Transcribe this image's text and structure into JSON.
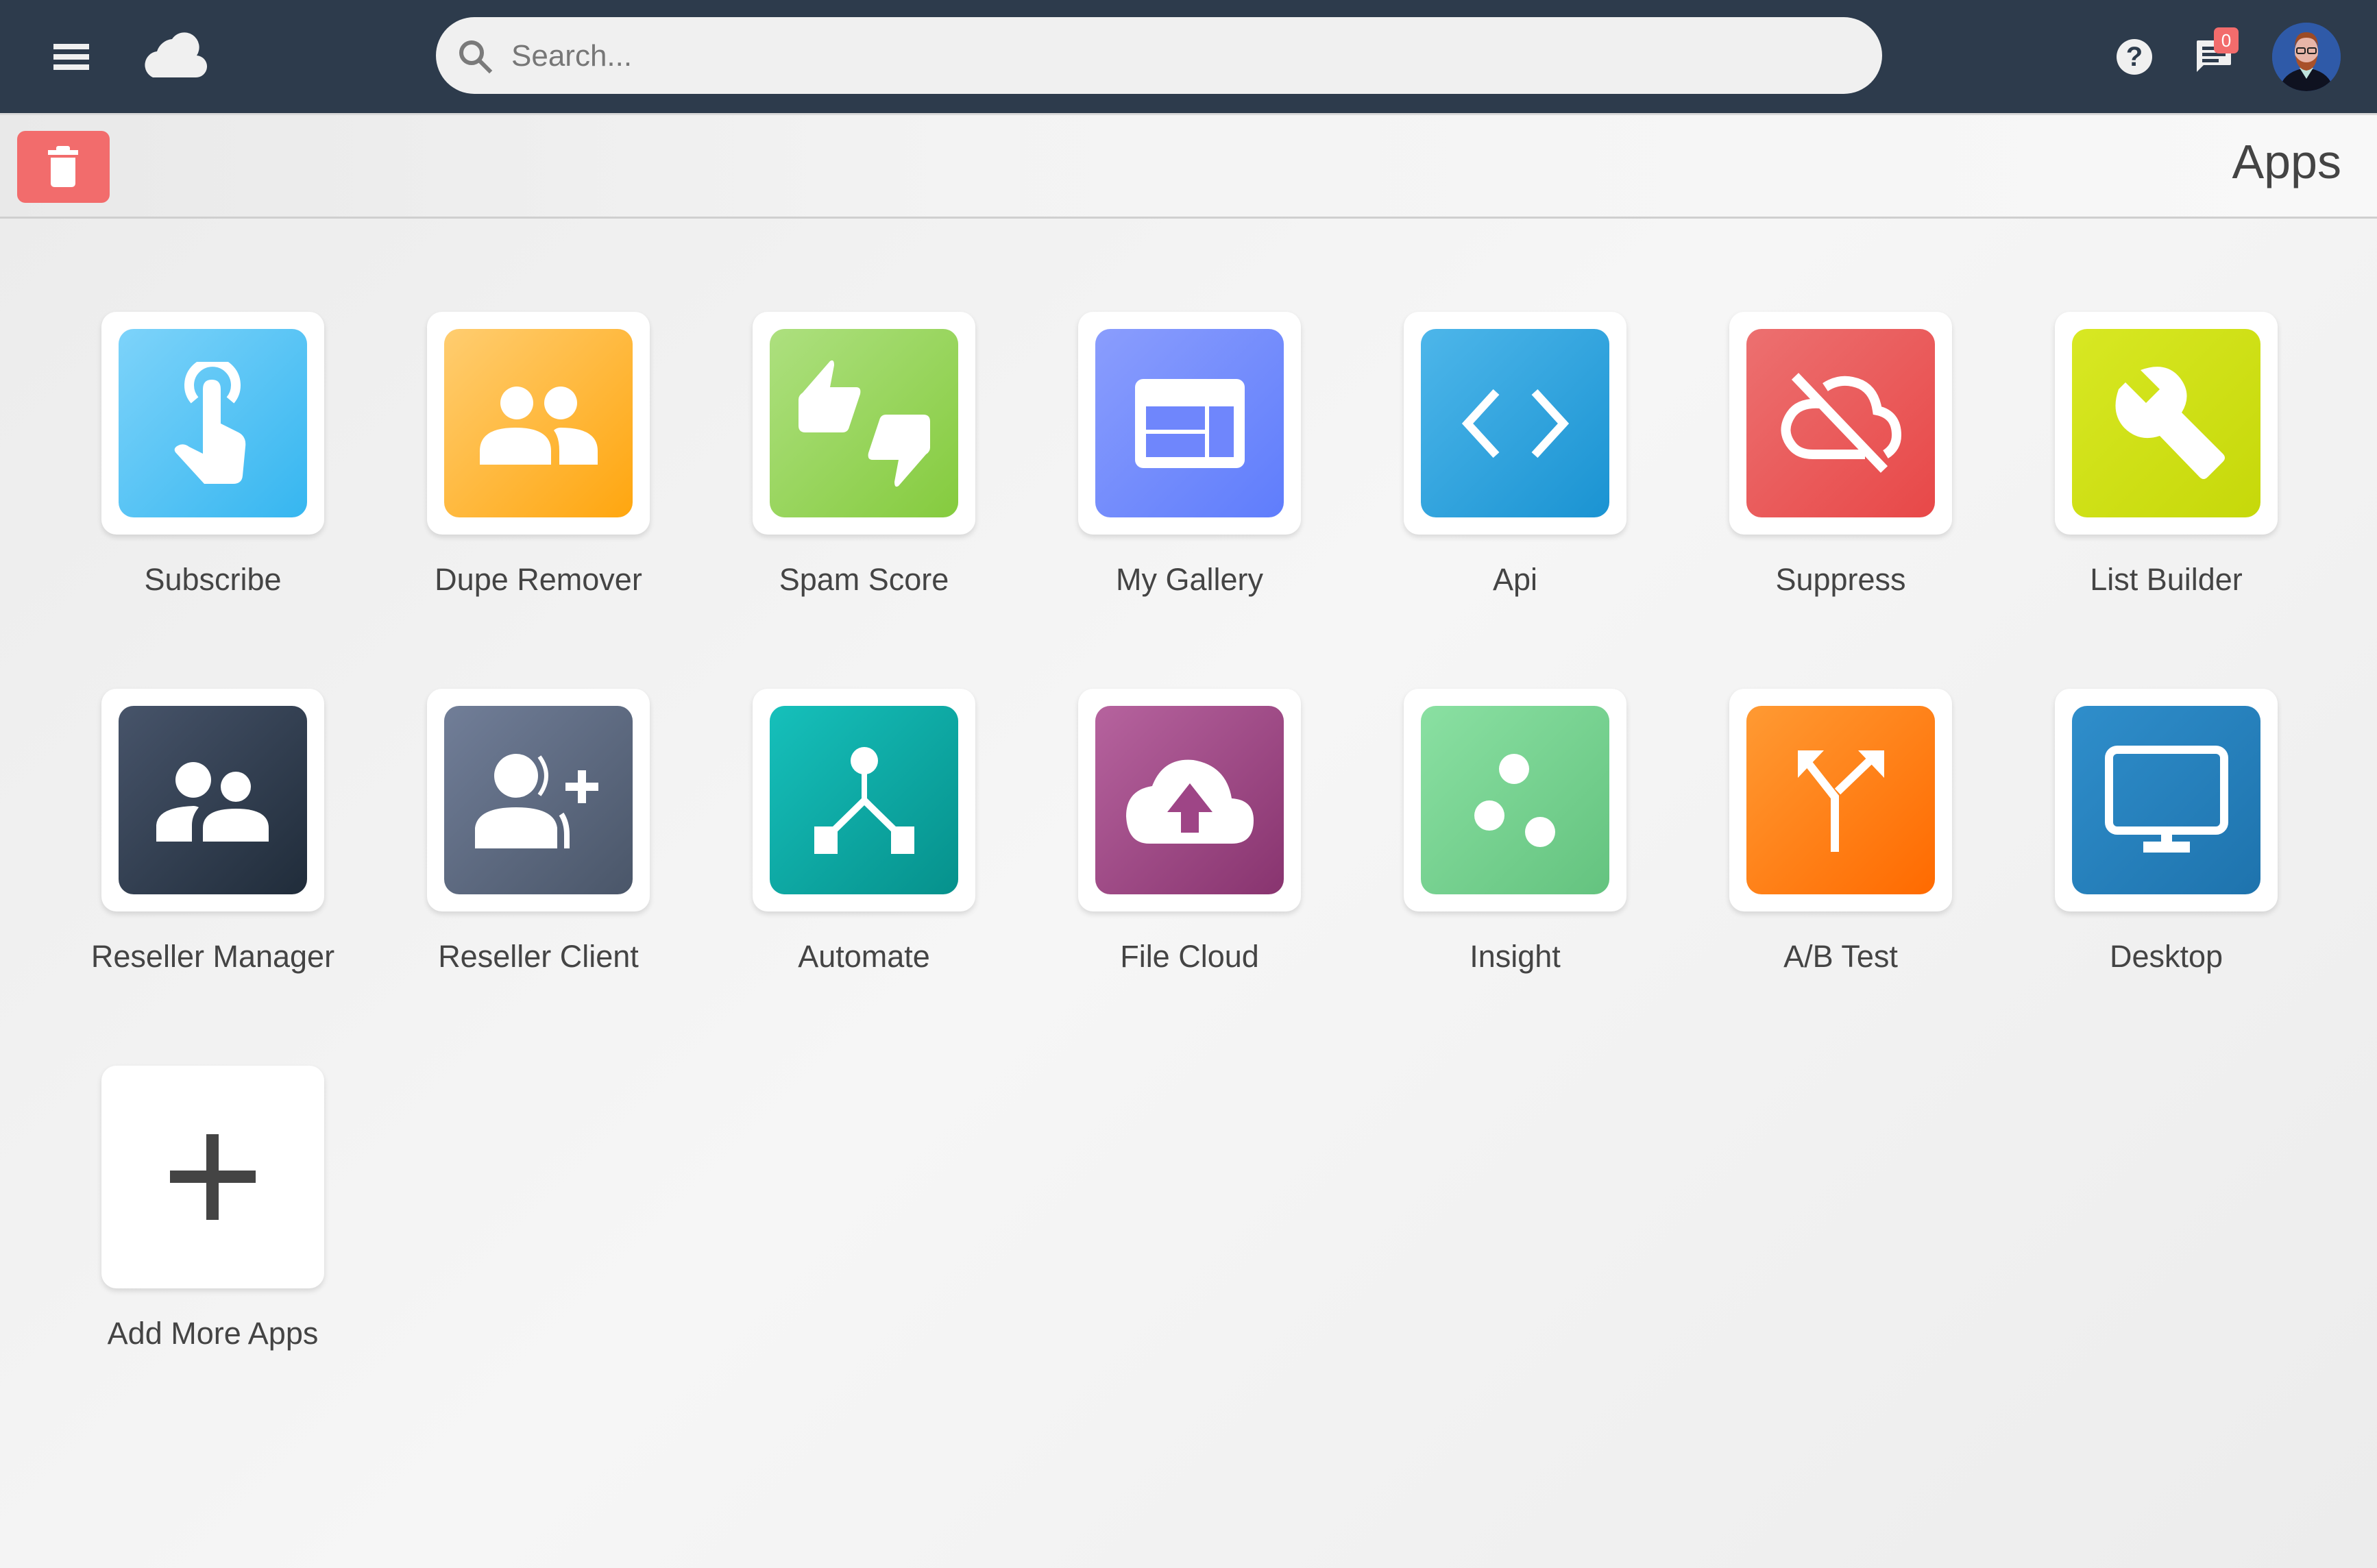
{
  "header": {
    "menu_icon": "hamburger-menu-icon",
    "logo_icon": "cloud-logo-icon",
    "search": {
      "placeholder": "Search...",
      "value": ""
    },
    "help_icon": "help-circle-icon",
    "messages": {
      "icon": "chat-bubble-icon",
      "badge_count": "0"
    },
    "avatar": "user-avatar"
  },
  "toolbar": {
    "delete_icon": "trash-icon",
    "title": "Apps"
  },
  "colors": {
    "header_bg": "#2d3b4c",
    "danger": "#f26c6c"
  },
  "apps": [
    {
      "label": "Subscribe",
      "icon": "tap-hand-icon",
      "gradient": [
        "#7dd3fa",
        "#36b6f0"
      ]
    },
    {
      "label": "Dupe Remover",
      "icon": "people-icon",
      "gradient": [
        "#ffcd70",
        "#ffa60f"
      ]
    },
    {
      "label": "Spam Score",
      "icon": "thumbs-up-down-icon",
      "gradient": [
        "#ade07f",
        "#85cb3e"
      ]
    },
    {
      "label": "My Gallery",
      "icon": "gallery-layout-icon",
      "gradient": [
        "#8a9dfd",
        "#5f7dfc"
      ]
    },
    {
      "label": "Api",
      "icon": "code-brackets-icon",
      "gradient": [
        "#4db6ea",
        "#1a93d2"
      ]
    },
    {
      "label": "Suppress",
      "icon": "cloud-off-icon",
      "gradient": [
        "#ec7070",
        "#e84848"
      ]
    },
    {
      "label": "List Builder",
      "icon": "wrench-icon",
      "gradient": [
        "#d8e823",
        "#c6d80a"
      ]
    },
    {
      "label": "Reseller Manager",
      "icon": "group-icon",
      "gradient": [
        "#47546a",
        "#202c3a"
      ]
    },
    {
      "label": "Reseller Client",
      "icon": "add-user-icon",
      "gradient": [
        "#717e98",
        "#4a5669"
      ]
    },
    {
      "label": "Automate",
      "icon": "workflow-branch-icon",
      "gradient": [
        "#16c0bb",
        "#06918c"
      ]
    },
    {
      "label": "File Cloud",
      "icon": "cloud-upload-icon",
      "gradient": [
        "#b6639e",
        "#88346f"
      ]
    },
    {
      "label": "Insight",
      "icon": "dots-scatter-icon",
      "gradient": [
        "#8ae0a2",
        "#64c37f"
      ]
    },
    {
      "label": "A/B Test",
      "icon": "split-arrows-icon",
      "gradient": [
        "#ff9a33",
        "#ff6a00"
      ]
    },
    {
      "label": "Desktop",
      "icon": "monitor-icon",
      "gradient": [
        "#2f8ecb",
        "#1e73ad"
      ]
    }
  ],
  "add_tile": {
    "label": "Add More Apps",
    "icon": "plus-icon"
  }
}
